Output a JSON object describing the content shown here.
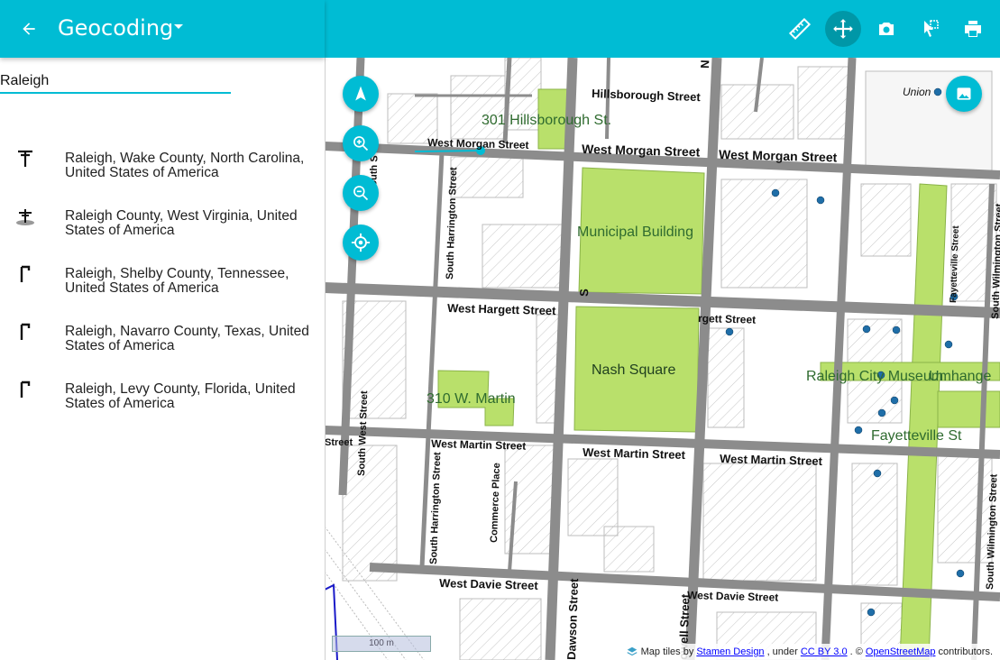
{
  "header": {
    "title": "Geocoding"
  },
  "search": {
    "value": "Raleigh"
  },
  "results": [
    {
      "label": "Raleigh, Wake County, North Carolina, United States of America",
      "icon": "city-icon"
    },
    {
      "label": "Raleigh County, West Virginia, United States of America",
      "icon": "county-icon"
    },
    {
      "label": "Raleigh, Shelby County, Tennessee, United States of America",
      "icon": "place-flag-icon"
    },
    {
      "label": "Raleigh, Navarro County, Texas, United States of America",
      "icon": "place-flag-icon"
    },
    {
      "label": "Raleigh, Levy County, Florida, United States of America",
      "icon": "place-flag-icon"
    }
  ],
  "toolbar": [
    "ruler-icon",
    "pan-move-icon",
    "camera-icon",
    "select-cursor-icon",
    "print-icon"
  ],
  "map": {
    "scale": "100 m",
    "streets": {
      "hillsborough": "Hillsborough Street",
      "morgan_w": "West Morgan Street",
      "morgan_c": "West Morgan Street",
      "morgan_e": "West Morgan Street",
      "hargett_w": "West Hargett Street",
      "hargett_e": "rgett Street",
      "martin_w": "West Martin Street",
      "martin_c": "West Martin Street",
      "martin_e": "West Martin Street",
      "martin_left": "Street",
      "davie_w": "West Davie Street",
      "davie_e": "West Davie Street",
      "harrington_n": "South Harrington Street",
      "harrington_s": "South Harrington Street",
      "commerce": "Commerce Place",
      "west_st": "South West Street",
      "dawson": "Dawson Street",
      "mcdowell": "owell Street",
      "wilmington_n": "South Wilmington Street",
      "wilmington_s": "South Wilmington Street",
      "fayetteville_n": "Fayetteville Street",
      "union": "Union",
      "s_frag": "S",
      "n_frag": "N",
      "so_frag": "South S"
    },
    "places": {
      "hillsborough_301": "301 Hillsborough St.",
      "municipal": "Municipal Building",
      "nash": "Nash Square",
      "martin_310": "310 W. Martin",
      "museum": "Raleigh City Museum",
      "umhange": "Umhange",
      "fayetteville": "Fayetteville St"
    }
  },
  "attribution": {
    "prefix": "Map tiles by",
    "stamen": "Stamen Design",
    "under": ", under",
    "license": "CC BY 3.0",
    "osm_prefix": ". ©",
    "osm": "OpenStreetMap",
    "suffix": "contributors."
  },
  "colors": {
    "accent": "#00bcd4",
    "park": "#b9e06b",
    "road": "#8c8c8c"
  }
}
